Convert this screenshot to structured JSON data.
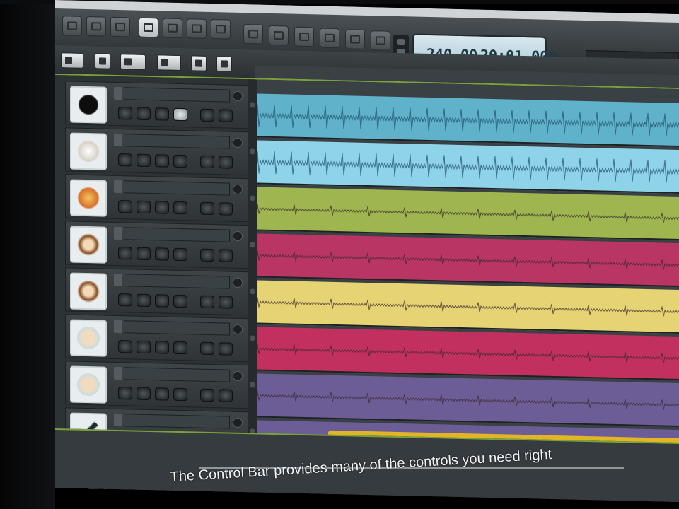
{
  "window": {
    "title": ""
  },
  "toolbar": {
    "buttons": [
      {
        "icon": "mixer-icon",
        "active": false
      },
      {
        "icon": "grid-icon",
        "active": false
      },
      {
        "icon": "list-icon",
        "active": false
      },
      {
        "icon": "window-icon",
        "active": true
      },
      {
        "icon": "edit-icon",
        "active": false
      },
      {
        "icon": "split-icon",
        "active": false
      },
      {
        "icon": "fx-icon",
        "active": false
      },
      {
        "icon": "rewind-icon",
        "active": false
      },
      {
        "icon": "stop-icon",
        "active": false
      },
      {
        "icon": "play-icon",
        "active": false
      },
      {
        "icon": "record-icon",
        "active": false
      },
      {
        "icon": "loop-icon",
        "active": false
      },
      {
        "icon": "metronome-icon",
        "active": false
      }
    ]
  },
  "transport": {
    "tempo": "240.00",
    "time": "20:01.000",
    "tempo_label": "",
    "time_label": ""
  },
  "secondary_toolbar": {
    "buttons": [
      {
        "icon": "pointer-icon"
      },
      {
        "icon": "pencil-icon"
      },
      {
        "icon": "scissors-icon"
      },
      {
        "icon": "zoom-icon"
      },
      {
        "icon": "snap-icon"
      },
      {
        "icon": "marker-icon"
      }
    ]
  },
  "tracks": [
    {
      "name": "",
      "icon": "kick-drum-icon",
      "color": "#5fb2c9"
    },
    {
      "name": "",
      "icon": "cymbal-icon",
      "color": "#8fd3e8"
    },
    {
      "name": "",
      "icon": "pizza-icon",
      "color": "#9fb650"
    },
    {
      "name": "",
      "icon": "bear-face-icon",
      "color": "#b83564"
    },
    {
      "name": "",
      "icon": "bear-face-icon",
      "color": "#e6d373"
    },
    {
      "name": "",
      "icon": "hand-icon",
      "color": "#c2305f"
    },
    {
      "name": "",
      "icon": "hand-icon",
      "color": "#6d5d96"
    },
    {
      "name": "",
      "icon": "guitar-icon",
      "color": "#e2b526"
    },
    {
      "name": "",
      "icon": "speaker-icon",
      "color": "#3c4549"
    }
  ],
  "caption": {
    "text": "The Control Bar provides many of the controls you need right"
  }
}
